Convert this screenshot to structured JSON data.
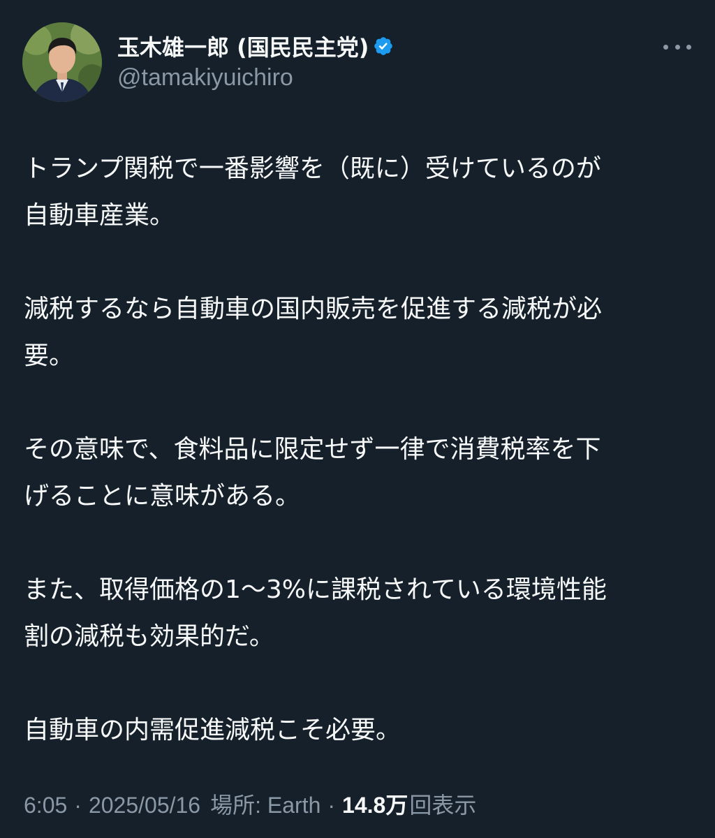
{
  "author": {
    "display_name": "玉木雄一郎 (国民民主党)",
    "handle": "@tamakiyuichiro",
    "verified": true,
    "verified_color": "#1d9bf0"
  },
  "tweet": {
    "paragraphs": [
      [
        "トランプ関税で一番影響を（既に）受けているのが",
        "自動車産業。"
      ],
      [
        "減税するなら自動車の国内販売を促進する減税が必",
        "要。"
      ],
      [
        "その意味で、食料品に限定せず一律で消費税率を下",
        "げることに意味がある。"
      ],
      [
        "また、取得価格の1〜3%に課税されている環境性能",
        "割の減税も効果的だ。"
      ],
      [
        "自動車の内需促進減税こそ必要。"
      ]
    ]
  },
  "meta": {
    "time": "6:05",
    "date": "2025/05/16",
    "location_label": "場所: Earth",
    "separator": "·",
    "views_count": "14.8万",
    "views_label": "回表示"
  },
  "icons": {
    "more": "more-horizontal-icon",
    "verified": "verified-badge-icon"
  },
  "colors": {
    "background": "#15202b",
    "text_primary": "#f7f9f9",
    "text_secondary": "#8b98a5"
  }
}
